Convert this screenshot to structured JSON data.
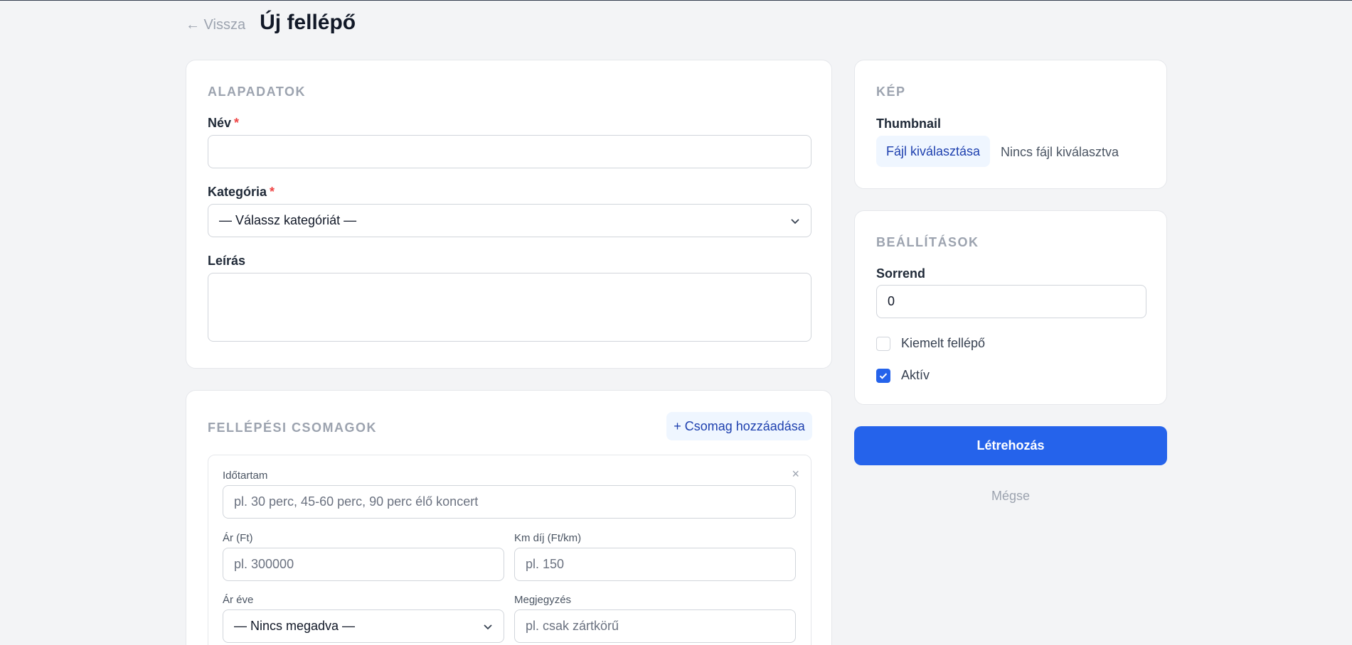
{
  "header": {
    "back_label": "← Vissza",
    "title": "Új fellépő"
  },
  "basics": {
    "section_title": "ALAPADATOK",
    "name_label": "Név",
    "required_mark": "*",
    "category_label": "Kategória",
    "category_value": "— Válassz kategóriát —",
    "description_label": "Leírás"
  },
  "packages": {
    "section_title": "FELLÉPÉSI CSOMAGOK",
    "add_button": "+ Csomag hozzáadása",
    "remove_icon": "×",
    "duration_label": "Időtartam",
    "duration_placeholder": "pl. 30 perc, 45-60 perc, 90 perc élő koncert",
    "price_label": "Ár (Ft)",
    "price_placeholder": "pl. 300000",
    "km_label": "Km díj (Ft/km)",
    "km_placeholder": "pl. 150",
    "price_year_label": "Ár éve",
    "price_year_value": "— Nincs megadva —",
    "note_label": "Megjegyzés",
    "note_placeholder": "pl. csak zártkörű"
  },
  "image": {
    "section_title": "KÉP",
    "thumbnail_label": "Thumbnail",
    "file_button": "Fájl kiválasztása",
    "file_status": "Nincs fájl kiválasztva"
  },
  "settings": {
    "section_title": "BEÁLLÍTÁSOK",
    "order_label": "Sorrend",
    "order_value": "0",
    "featured_label": "Kiemelt fellépő",
    "featured_checked": false,
    "active_label": "Aktív",
    "active_checked": true
  },
  "actions": {
    "create_button": "Létrehozás",
    "cancel_link": "Mégse"
  },
  "colors": {
    "primary": "#2563eb",
    "background": "#f3f4f6",
    "required": "#ef4444"
  }
}
